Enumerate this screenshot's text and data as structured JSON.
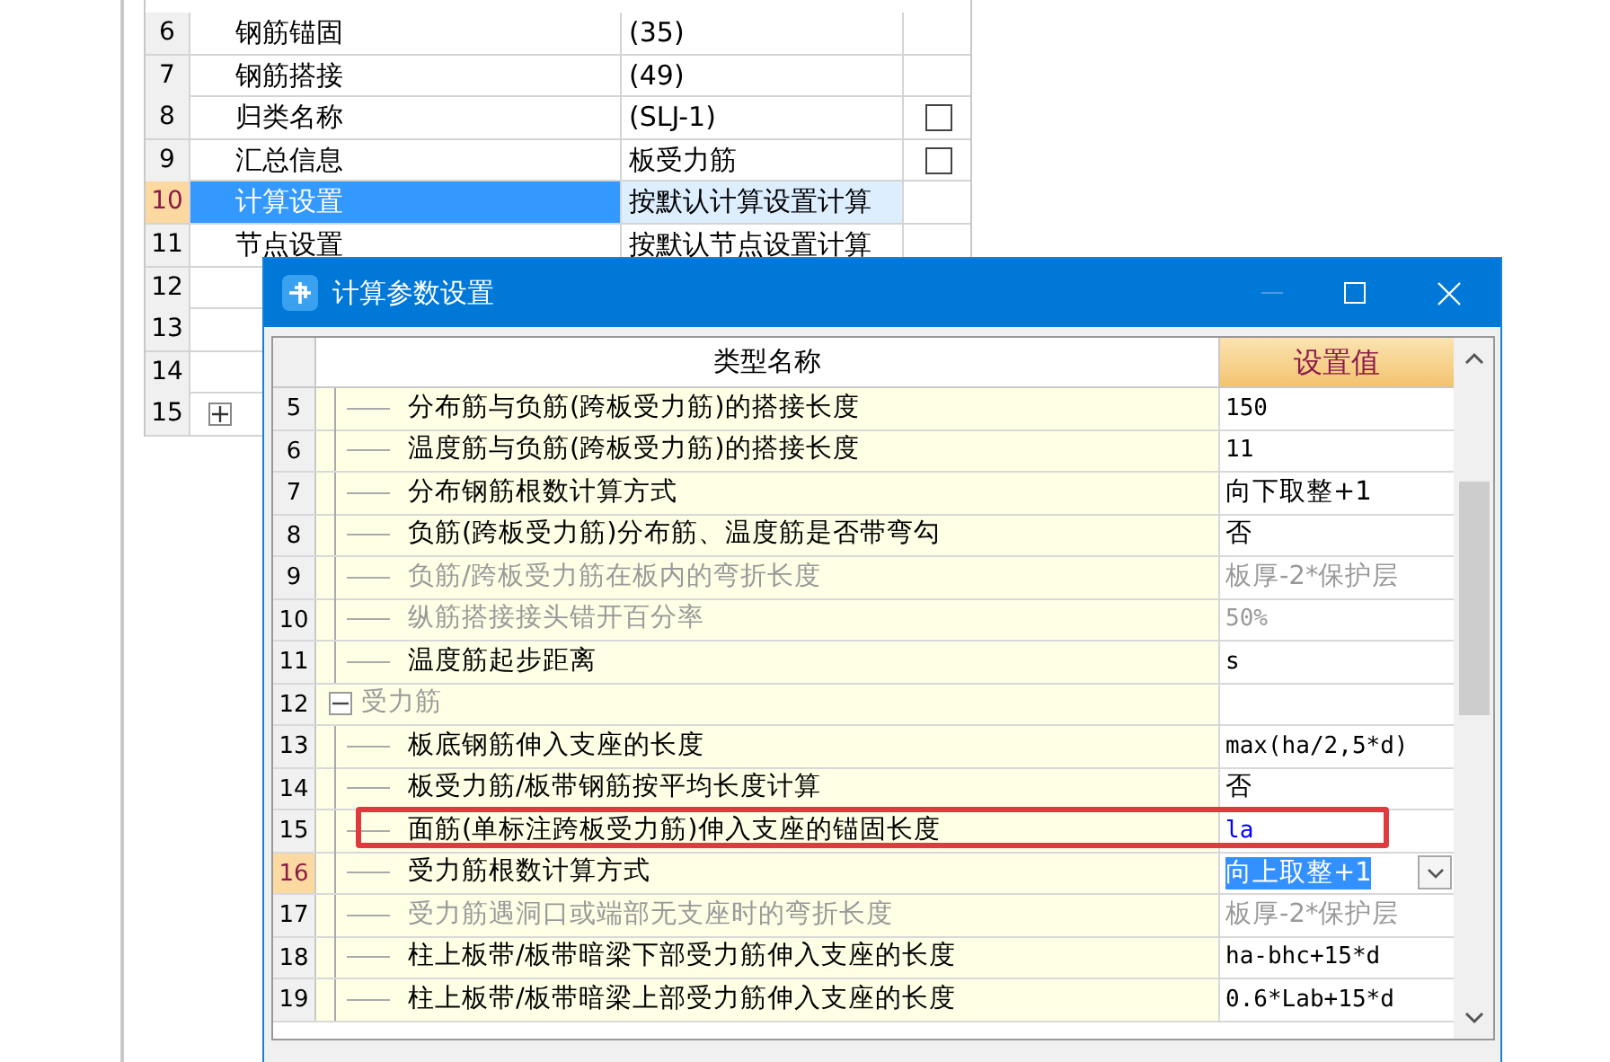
{
  "property_grid": {
    "rows": [
      {
        "number": "6",
        "name": "钢筋锚固",
        "value": "(35)",
        "selected": false
      },
      {
        "number": "7",
        "name": "钢筋搭接",
        "value": "(49)",
        "selected": false
      },
      {
        "number": "8",
        "name": "归类名称",
        "value": "(SLJ-1)",
        "checked": false,
        "selected": false
      },
      {
        "number": "9",
        "name": "汇总信息",
        "value": "板受力筋",
        "checked": false,
        "selected": false
      },
      {
        "number": "10",
        "name": "计算设置",
        "value": "按默认计算设置计算",
        "selected": true
      },
      {
        "number": "11",
        "name": "节点设置",
        "value": "按默认节点设置计算",
        "selected": false
      },
      {
        "number": "12",
        "selected": false
      },
      {
        "number": "13",
        "selected": false
      },
      {
        "number": "14",
        "selected": false
      },
      {
        "number": "15",
        "expandable": true,
        "selected": false
      }
    ]
  },
  "dialog": {
    "title": "计算参数设置",
    "columns": [
      "类型名称",
      "设置值"
    ],
    "rows": [
      {
        "number": "5",
        "kind": "item",
        "name": "分布筋与负筋(跨板受力筋)的搭接长度",
        "value": "150",
        "disabled": false,
        "selected": false
      },
      {
        "number": "6",
        "kind": "item",
        "name": "温度筋与负筋(跨板受力筋)的搭接长度",
        "value": "11",
        "disabled": false,
        "selected": false
      },
      {
        "number": "7",
        "kind": "item",
        "name": "分布钢筋根数计算方式",
        "value": "向下取整+1",
        "disabled": false,
        "selected": false
      },
      {
        "number": "8",
        "kind": "item",
        "name": "负筋(跨板受力筋)分布筋、温度筋是否带弯勾",
        "value": "否",
        "disabled": false,
        "selected": false
      },
      {
        "number": "9",
        "kind": "item",
        "name": "负筋/跨板受力筋在板内的弯折长度",
        "value": "板厚-2*保护层",
        "disabled": true,
        "selected": false
      },
      {
        "number": "10",
        "kind": "item",
        "name": "纵筋搭接接头错开百分率",
        "value": "50%",
        "disabled": true,
        "selected": false
      },
      {
        "number": "11",
        "kind": "item",
        "name": "温度筋起步距离",
        "value": "s",
        "disabled": false,
        "selected": false
      },
      {
        "number": "12",
        "kind": "group",
        "name": "受力筋",
        "expanded": true,
        "disabled": true,
        "selected": false,
        "children": [
          {
            "number": "13",
            "kind": "item",
            "name": "板底钢筋伸入支座的长度",
            "value": "max(ha/2,5*d)",
            "disabled": false,
            "selected": false
          },
          {
            "number": "14",
            "kind": "item",
            "name": "板受力筋/板带钢筋按平均长度计算",
            "value": "否",
            "disabled": false,
            "selected": false
          },
          {
            "number": "15",
            "kind": "item",
            "name": "面筋(单标注跨板受力筋)伸入支座的锚固长度",
            "value": "la",
            "disabled": false,
            "modified": true,
            "highlighted": true,
            "selected": false
          },
          {
            "number": "16",
            "kind": "item",
            "name": "受力筋根数计算方式",
            "value": "向上取整+1",
            "disabled": false,
            "selected": true
          },
          {
            "number": "17",
            "kind": "item",
            "name": "受力筋遇洞口或端部无支座时的弯折长度",
            "value": "板厚-2*保护层",
            "disabled": true,
            "selected": false
          },
          {
            "number": "18",
            "kind": "item",
            "name": "柱上板带/板带暗梁下部受力筋伸入支座的长度",
            "value": "ha-bhc+15*d",
            "disabled": false,
            "selected": false
          },
          {
            "number": "19",
            "kind": "item",
            "name": "柱上板带/板带暗梁上部受力筋伸入支座的长度",
            "value": "0.6*Lab+15*d",
            "disabled": false,
            "selected": false
          }
        ]
      }
    ]
  }
}
